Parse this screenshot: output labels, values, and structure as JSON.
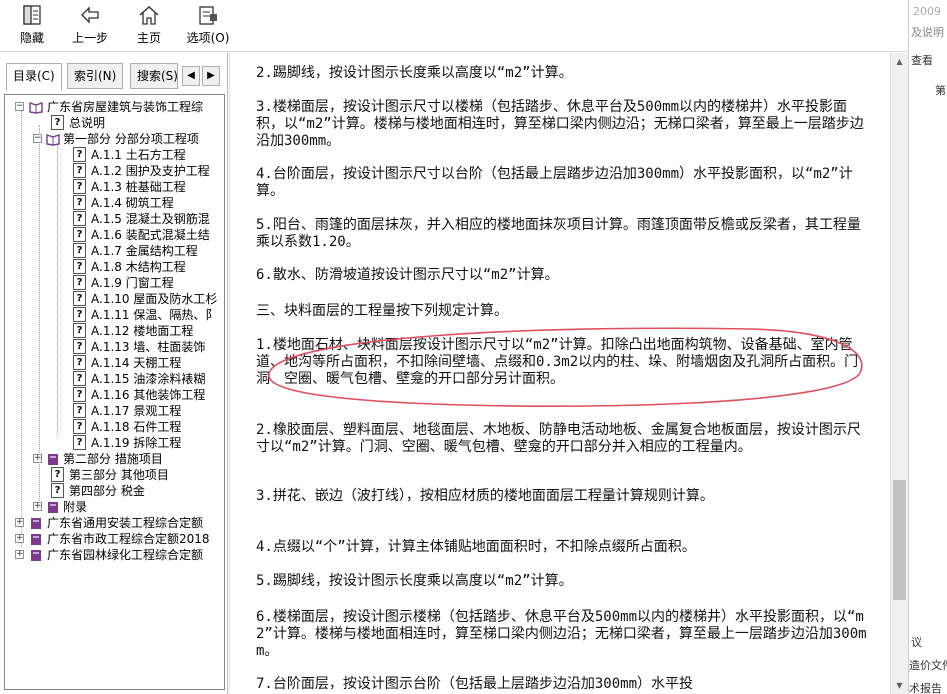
{
  "toolbar": {
    "hide": "隐藏",
    "back": "上一步",
    "home": "主页",
    "options": "选项(O)"
  },
  "tabs": {
    "contents": "目录(C)",
    "index": "索引(N)",
    "search": "搜索(S)"
  },
  "tree": {
    "root": "广东省房屋建筑与装饰工程综",
    "overview": "总说明",
    "part1": "第一部分 分部分项工程项",
    "items": [
      "A.1.1 土石方工程",
      "A.1.2 围护及支护工程",
      "A.1.3 桩基础工程",
      "A.1.4 砌筑工程",
      "A.1.5 混凝土及钢筋混",
      "A.1.6 装配式混凝土结",
      "A.1.7 金属结构工程",
      "A.1.8 木结构工程",
      "A.1.9 门窗工程",
      "A.1.10 屋面及防水工杉",
      "A.1.11 保温、隔热、阝",
      "A.1.12 楼地面工程",
      "A.1.13 墙、柱面装饰",
      "A.1.14 天棚工程",
      "A.1.15 油漆涂料裱糊",
      "A.1.16 其他装饰工程",
      "A.1.17 景观工程",
      "A.1.18 石件工程",
      "A.1.19 拆除工程"
    ],
    "part2": "第二部分 措施项目",
    "part3": "第三部分 其他项目",
    "part4": "第四部分 税金",
    "appendix": "附录",
    "book2": "广东省通用安装工程综合定额",
    "book3": "广东省市政工程综合定额2018",
    "book4": "广东省园林绿化工程综合定额"
  },
  "content": {
    "p1": "2.踢脚线，按设计图示长度乘以高度以“m2”计算。",
    "p2": "3.楼梯面层，按设计图示尺寸以楼梯（包括踏步、休息平台及500mm以内的楼梯井）水平投影面积，以“m2”计算。楼梯与楼地面相连时，算至梯口梁内侧边沿；无梯口梁者，算至最上一层踏步边沿加300mm。",
    "p3": "4.台阶面层，按设计图示尺寸以台阶（包括最上层踏步边沿加300mm）水平投影面积，以“m2”计算。",
    "p4": "5.阳台、雨篷的面层抹灰，并入相应的楼地面抹灰项目计算。雨篷顶面带反檐或反梁者，其工程量乘以系数1.20。",
    "p5": "6.散水、防滑坡道按设计图示尺寸以“m2”计算。",
    "p6": "三、块料面层的工程量按下列规定计算。",
    "p7": "1.楼地面石材、块料面层按设计图示尺寸以“m2”计算。扣除凸出地面构筑物、设备基础、室内管道、地沟等所占面积，不扣除间壁墙、点缀和0.3m2以内的柱、垛、附墙烟囱及孔洞所占面积。门洞、空圈、暖气包槽、壁龛的开口部分另计面积。",
    "p8": "2.橡胶面层、塑料面层、地毯面层、木地板、防静电活动地板、金属复合地板面层，按设计图示尺寸以“m2”计算。门洞、空圈、暖气包槽、壁龛的开口部分并入相应的工程量内。",
    "p9": "3.拼花、嵌边（波打线），按相应材质的楼地面面层工程量计算规则计算。",
    "p10": "4.点缀以“个”计算，计算主体铺贴地面面积时，不扣除点缀所占面积。",
    "p11": "5.踢脚线，按设计图示长度乘以高度以“m2”计算。",
    "p12": "6.楼梯面层，按设计图示楼梯（包括踏步、休息平台及500mm以内的楼梯井）水平投影面积，以“m2”计算。楼梯与楼地面相连时，算至梯口梁内侧边沿；无梯口梁者，算至最上一层踏步边沿加300mm。",
    "p13": "7.台阶面层，按设计图示台阶（包括最上层踏步边沿加300mm）水平投"
  },
  "edge": {
    "t1": "2009",
    "t2": "及说明",
    "t3": "查看",
    "t4": "第",
    "t5": "议",
    "t6": "造价文件",
    "t7": "术报告"
  },
  "colors": {
    "annotation": "#e0505a",
    "book": "#7b3a8c"
  }
}
